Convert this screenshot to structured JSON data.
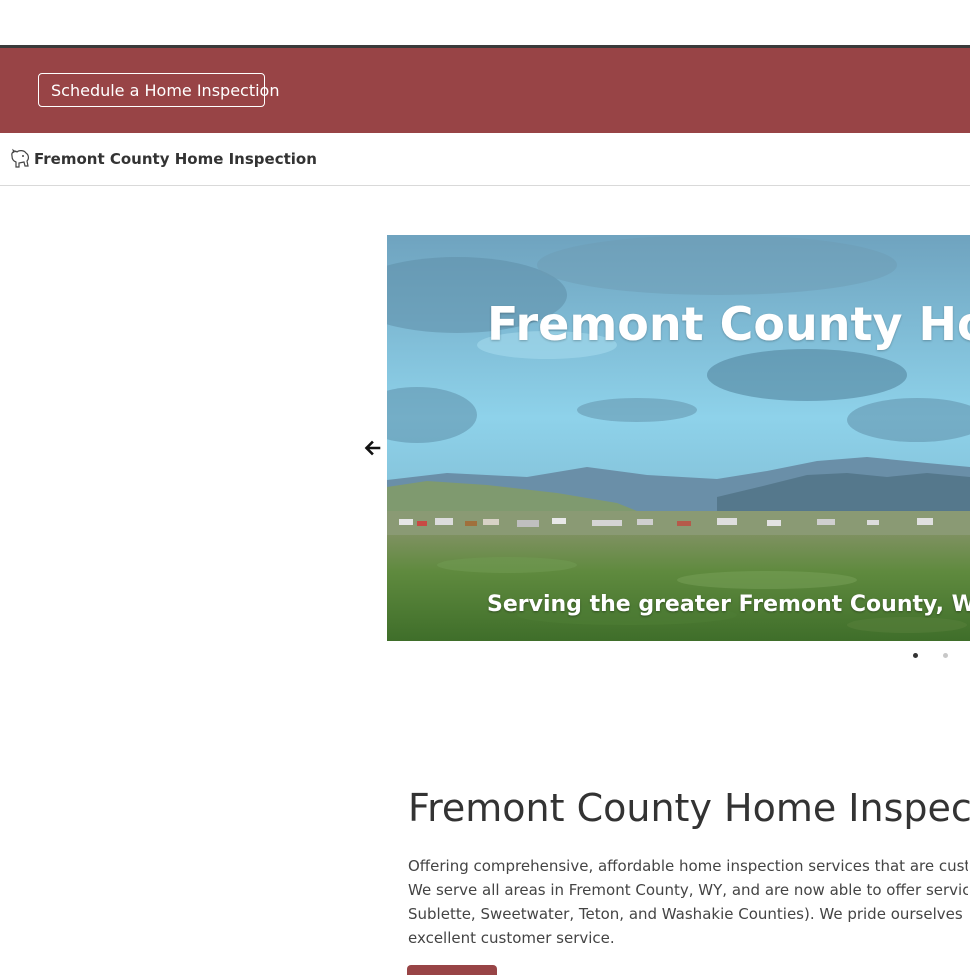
{
  "banner": {
    "schedule_label": "Schedule a Home Inspection",
    "background_color": "#984446"
  },
  "navbar": {
    "brand_name": "Fremont County Home Inspection",
    "logo_icon": "bear-logo-icon"
  },
  "carousel": {
    "title": "Fremont County Hom",
    "caption": "Serving the greater Fremont County, Wyom",
    "prev_icon": "arrow-left-icon",
    "slide_count": 2,
    "active_slide": 1
  },
  "main": {
    "title": "Fremont County Home Inspecti",
    "intro_lines": [
      "Offering comprehensive, affordable home inspection services that are customize",
      "We serve all areas in Fremont County, WY, and are now able to offer services in t",
      "Sublette, Sweetwater, Teton, and Washakie Counties). We pride ourselves on qua",
      "excellent customer service."
    ],
    "accent_color": "#984446"
  }
}
